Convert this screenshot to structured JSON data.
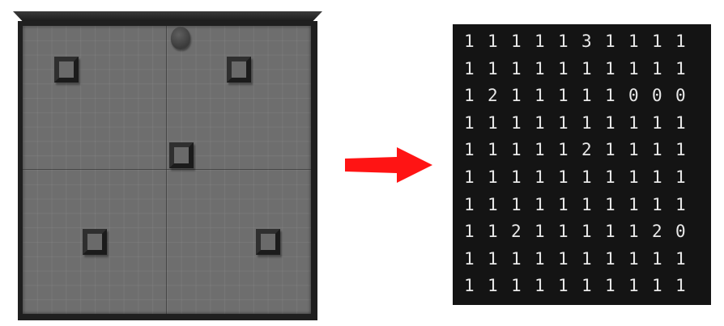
{
  "board": {
    "obstacles": [
      {
        "row": 1,
        "col": 1
      },
      {
        "row": 1,
        "col": 7
      },
      {
        "row": 4,
        "col": 5
      },
      {
        "row": 7,
        "col": 2
      },
      {
        "row": 7,
        "col": 8
      }
    ],
    "agent": {
      "row": 0,
      "col": 5
    },
    "colors": {
      "surface": "#6e6e6e",
      "frame": "#1f1f1f",
      "obstacle": "#2f2f2f"
    }
  },
  "arrow": {
    "color": "#ff1414"
  },
  "matrix": {
    "background": "#141414",
    "text_color": "#e8e8e8",
    "rows": [
      [
        "1",
        "1",
        "1",
        "1",
        "1",
        "3",
        "1",
        "1",
        "1",
        "1"
      ],
      [
        "1",
        "1",
        "1",
        "1",
        "1",
        "1",
        "1",
        "1",
        "1",
        "1"
      ],
      [
        "1",
        "2",
        "1",
        "1",
        "1",
        "1",
        "1",
        "0",
        "0",
        "0"
      ],
      [
        "1",
        "1",
        "1",
        "1",
        "1",
        "1",
        "1",
        "1",
        "1",
        "1"
      ],
      [
        "1",
        "1",
        "1",
        "1",
        "1",
        "2",
        "1",
        "1",
        "1",
        "1"
      ],
      [
        "1",
        "1",
        "1",
        "1",
        "1",
        "1",
        "1",
        "1",
        "1",
        "1"
      ],
      [
        "1",
        "1",
        "1",
        "1",
        "1",
        "1",
        "1",
        "1",
        "1",
        "1"
      ],
      [
        "1",
        "1",
        "2",
        "1",
        "1",
        "1",
        "1",
        "1",
        "2",
        "0"
      ],
      [
        "1",
        "1",
        "1",
        "1",
        "1",
        "1",
        "1",
        "1",
        "1",
        "1"
      ],
      [
        "1",
        "1",
        "1",
        "1",
        "1",
        "1",
        "1",
        "1",
        "1",
        "1"
      ]
    ]
  }
}
